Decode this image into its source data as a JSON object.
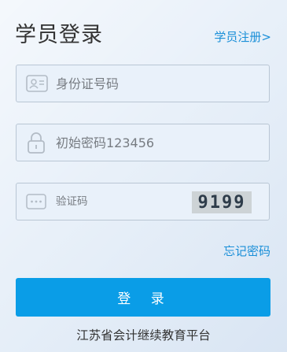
{
  "header": {
    "title": "学员登录",
    "register_link": "学员注册>"
  },
  "form": {
    "id_field": {
      "placeholder": "身份证号码",
      "icon": "id-card-icon"
    },
    "password_field": {
      "placeholder": "初始密码123456",
      "icon": "lock-icon"
    },
    "captcha_field": {
      "placeholder": "验证码",
      "icon": "dots-icon",
      "captcha_text": "9199"
    },
    "forgot_link": "忘记密码",
    "login_button": "登 录"
  },
  "footer": {
    "text": "江苏省会计继续教育平台"
  },
  "colors": {
    "accent": "#0a9de7",
    "link": "#1a8fd8",
    "border": "#b9c6d4",
    "background": "#e9f1fa"
  }
}
